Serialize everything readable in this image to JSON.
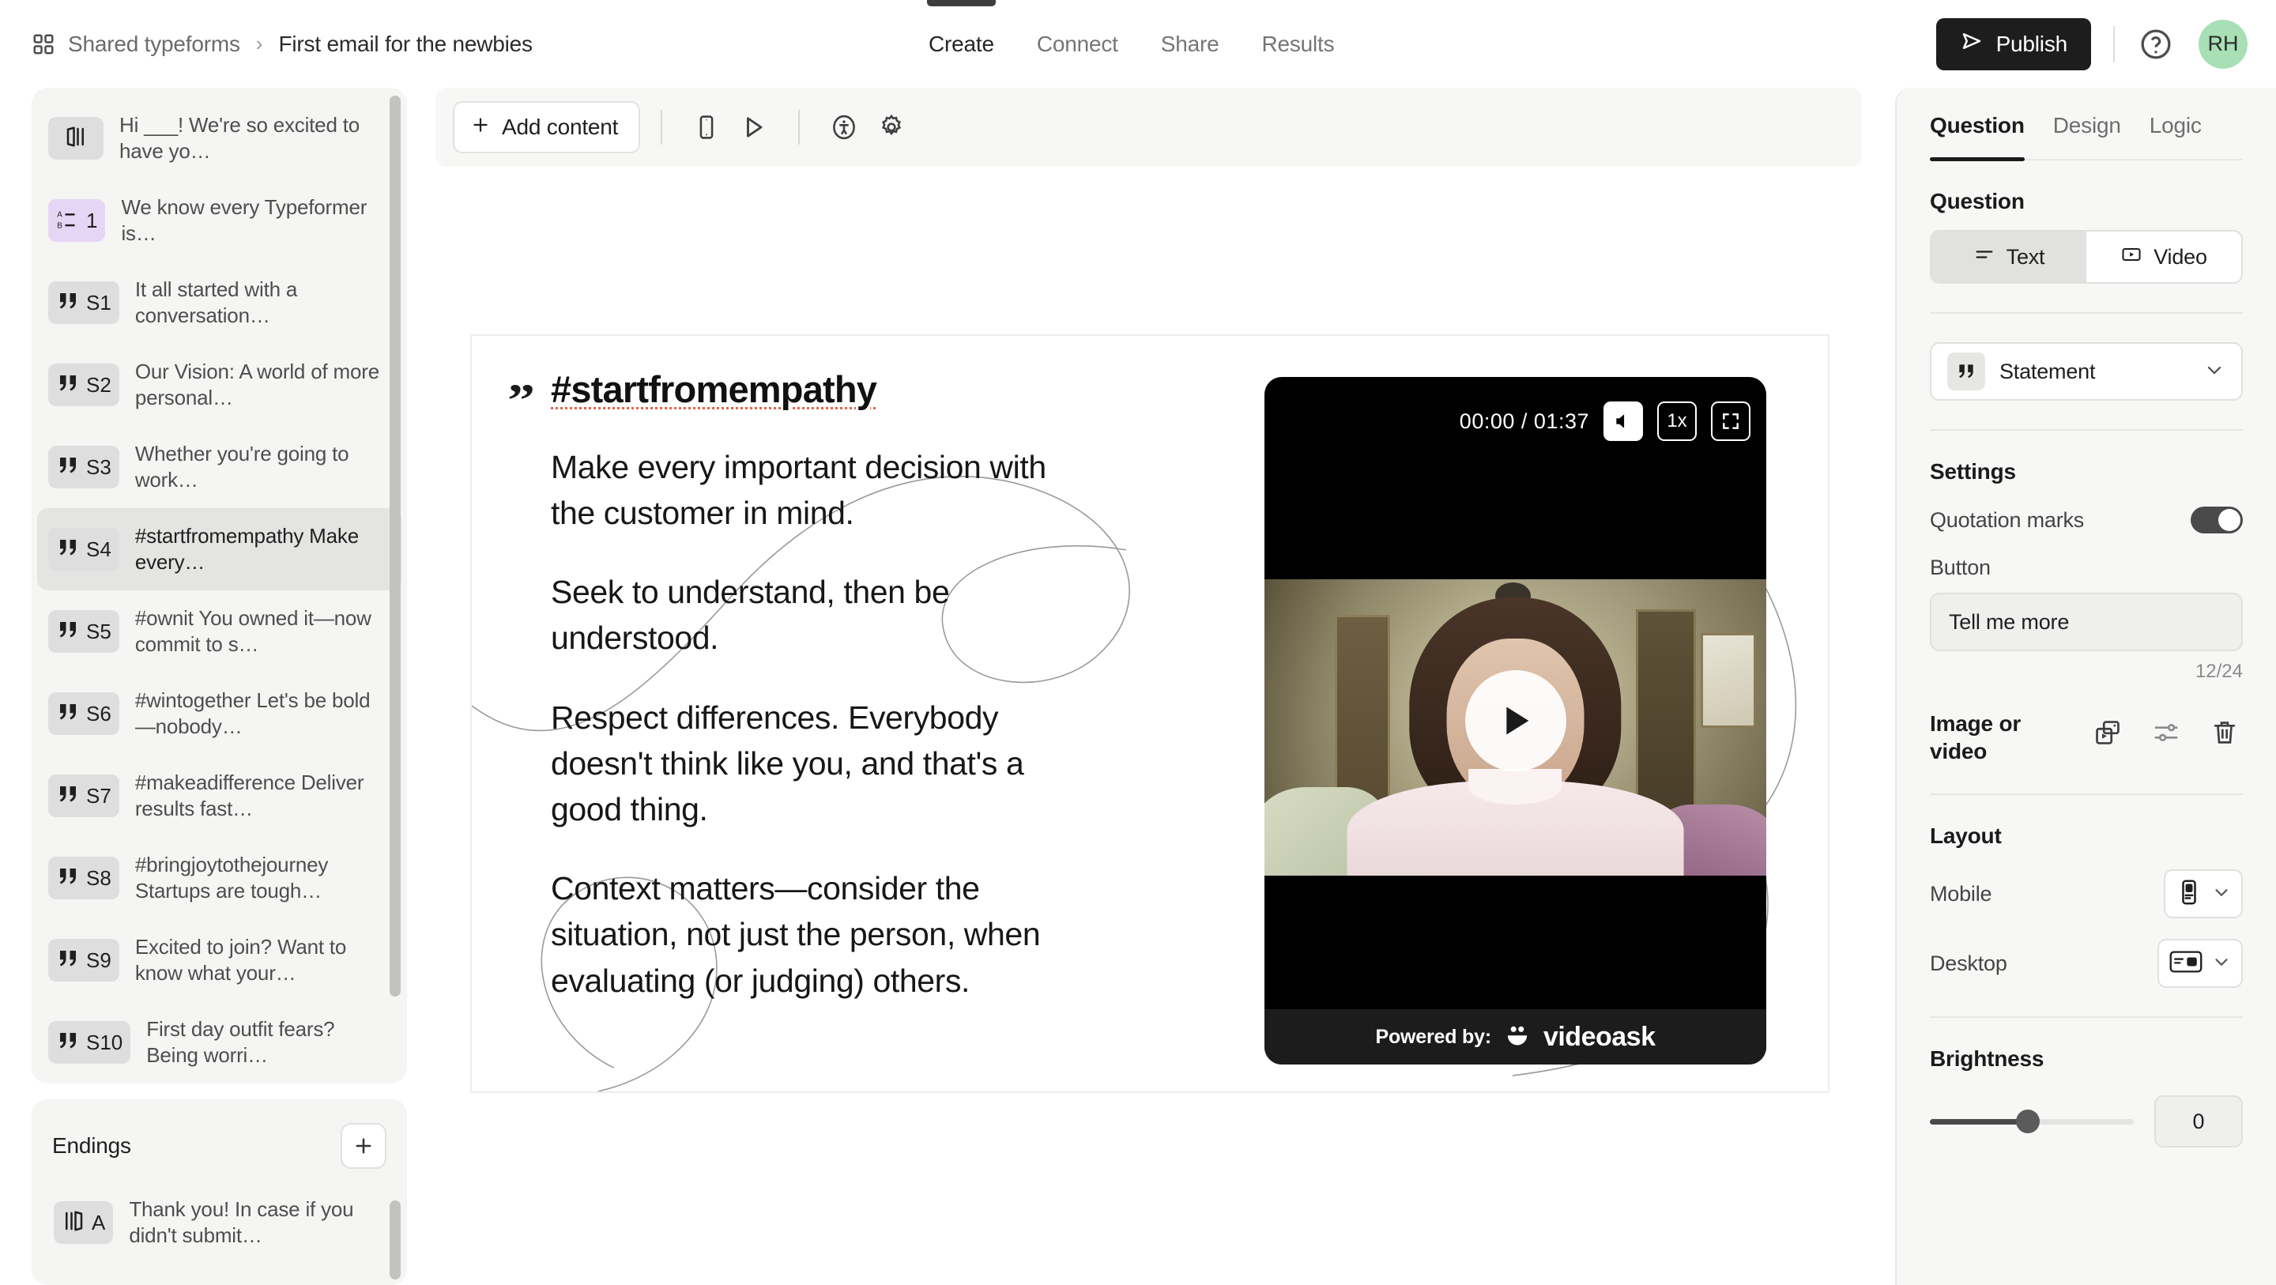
{
  "header": {
    "workspace": "Shared typeforms",
    "separator": "›",
    "form_title": "First email for the newbies",
    "tabs": [
      {
        "label": "Create",
        "active": true
      },
      {
        "label": "Connect",
        "active": false
      },
      {
        "label": "Share",
        "active": false
      },
      {
        "label": "Results",
        "active": false
      }
    ],
    "publish_label": "Publish",
    "avatar_initials": "RH",
    "avatar_color": "#a8dfb4",
    "icons": {
      "workspace": "grid-icon",
      "publish": "send-icon",
      "help": "help-circle-icon"
    }
  },
  "sidebar": {
    "items": [
      {
        "badge": "",
        "icon": "welcome-screen-icon",
        "text": "Hi ___! We're so excited to have yo…",
        "selected": false,
        "badge_color": "#dedede"
      },
      {
        "badge": "1",
        "icon": "multiple-choice-icon",
        "text": "We know every Typeformer is…",
        "selected": false,
        "badge_color": "#e6d6f5"
      },
      {
        "badge": "S1",
        "icon": "statement-icon",
        "text": "It all started with a conversation…",
        "selected": false,
        "badge_color": "#dedede"
      },
      {
        "badge": "S2",
        "icon": "statement-icon",
        "text": "Our Vision: A world of more personal…",
        "selected": false,
        "badge_color": "#dedede"
      },
      {
        "badge": "S3",
        "icon": "statement-icon",
        "text": "Whether you're going to work…",
        "selected": false,
        "badge_color": "#dedede"
      },
      {
        "badge": "S4",
        "icon": "statement-icon",
        "text": "#startfromempathy Make every…",
        "selected": true,
        "badge_color": "#dedede"
      },
      {
        "badge": "S5",
        "icon": "statement-icon",
        "text": "#ownit You owned it—now commit to s…",
        "selected": false,
        "badge_color": "#dedede"
      },
      {
        "badge": "S6",
        "icon": "statement-icon",
        "text": "#wintogether Let's be bold—nobody…",
        "selected": false,
        "badge_color": "#dedede"
      },
      {
        "badge": "S7",
        "icon": "statement-icon",
        "text": "#makeadifference Deliver results fast…",
        "selected": false,
        "badge_color": "#dedede"
      },
      {
        "badge": "S8",
        "icon": "statement-icon",
        "text": "#bringjoytothejourney Startups are tough…",
        "selected": false,
        "badge_color": "#dedede"
      },
      {
        "badge": "S9",
        "icon": "statement-icon",
        "text": "Excited to join? Want to know what your…",
        "selected": false,
        "badge_color": "#dedede"
      },
      {
        "badge": "S10",
        "icon": "statement-icon",
        "text": "First day outfit fears? Being worri…",
        "selected": false,
        "badge_color": "#dedede"
      }
    ],
    "endings": {
      "title": "Endings",
      "add_icon": "plus-icon",
      "items": [
        {
          "badge": "A",
          "icon": "ending-screen-icon",
          "text": "Thank you! In case if you didn't submit…",
          "selected": false
        }
      ]
    }
  },
  "toolbar": {
    "add_content_label": "Add content",
    "icons": [
      "plus-icon",
      "mobile-preview-icon",
      "play-preview-icon",
      "accessibility-icon",
      "settings-gear-icon"
    ]
  },
  "slide": {
    "quote_mark": "”",
    "heading": "#startfromempathy",
    "paragraphs": [
      "Make every important decision with the customer in mind.",
      "Seek to understand, then be understood.",
      "Respect differences. Everybody doesn't think like you, and that's a good thing.",
      "Context matters—consider the situation, not just the person, when evaluating (or judging) others."
    ],
    "spellcheck_color": "#e8634a"
  },
  "video": {
    "time_current": "00:00",
    "time_separator": "/",
    "time_total": "01:37",
    "speed_label": "1x",
    "mute_icon": "volume-icon",
    "fullscreen_icon": "fullscreen-icon",
    "play_icon": "play-icon",
    "footer_label": "Powered by:",
    "footer_brand": "videoask"
  },
  "rightpanel": {
    "tabs": [
      {
        "label": "Question",
        "active": true
      },
      {
        "label": "Design",
        "active": false
      },
      {
        "label": "Logic",
        "active": false
      }
    ],
    "question_section_title": "Question",
    "question_type_options": [
      {
        "label": "Text",
        "icon": "text-lines-icon",
        "active": true
      },
      {
        "label": "Video",
        "icon": "video-box-icon",
        "active": false
      }
    ],
    "field_type": {
      "label": "Statement",
      "icon": "statement-icon",
      "chevron": "chevron-down-icon"
    },
    "settings_title": "Settings",
    "quotation_marks_label": "Quotation marks",
    "quotation_marks_on": true,
    "button_label": "Button",
    "button_value": "Tell me more",
    "button_counter": "12/24",
    "media_title": "Image or video",
    "media_actions": [
      "replace-media-icon",
      "adjust-sliders-icon",
      "delete-trash-icon"
    ],
    "layout_title": "Layout",
    "layout_rows": [
      {
        "label": "Mobile",
        "icon": "mobile-layout-icon"
      },
      {
        "label": "Desktop",
        "icon": "desktop-layout-icon"
      }
    ],
    "brightness_title": "Brightness",
    "brightness_value": "0",
    "brightness_percent": 48
  }
}
